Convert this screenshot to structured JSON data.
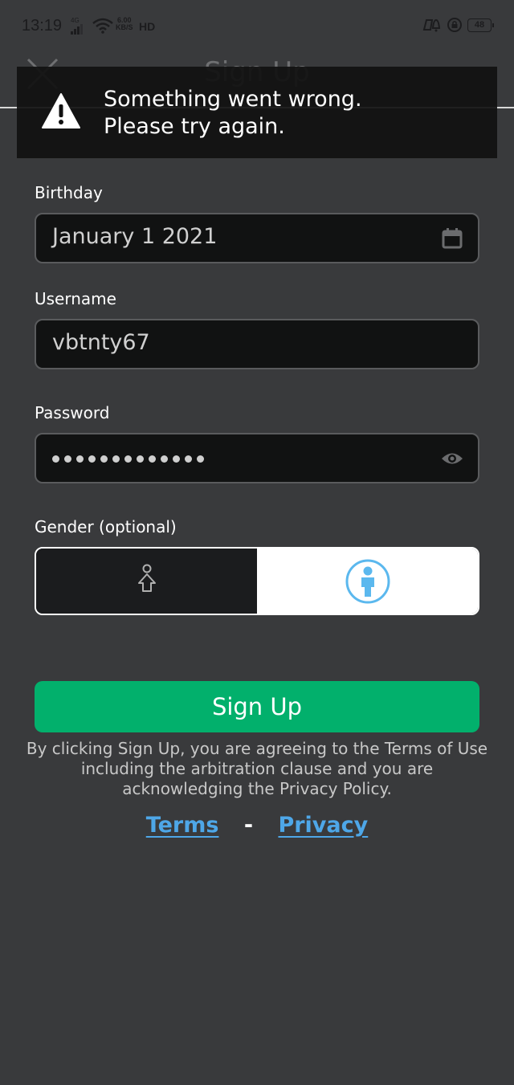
{
  "status_bar": {
    "time": "13:19",
    "network": "4G",
    "speed_value": "6.00",
    "speed_unit": "KB/S",
    "hd_label": "HD",
    "battery": "48",
    "icons": [
      "signal-icon",
      "wifi-icon",
      "hd-call-icon",
      "game-notification-icon",
      "rotation-lock-icon",
      "battery-icon"
    ]
  },
  "header": {
    "title": "Sign Up",
    "close_icon": "close-icon"
  },
  "toast": {
    "icon": "warning-icon",
    "line1": "Something went wrong.",
    "line2": "Please try again."
  },
  "form": {
    "birthday": {
      "label": "Birthday",
      "value": "January 1 2021",
      "icon": "calendar-icon"
    },
    "username": {
      "label": "Username",
      "value": "vbtnty67"
    },
    "password": {
      "label": "Password",
      "masked_length": 13,
      "icon": "eye-icon"
    },
    "gender": {
      "label": "Gender (optional)",
      "options": [
        {
          "name": "female",
          "icon": "female-icon",
          "selected": false
        },
        {
          "name": "male",
          "icon": "male-icon",
          "selected": true
        }
      ]
    }
  },
  "signup_button": {
    "label": "Sign Up",
    "color": "#02b06c"
  },
  "legal": {
    "text": "By clicking Sign Up, you are agreeing to the Terms of Use including the arbitration clause and you are acknowledging the Privacy Policy."
  },
  "links": {
    "terms": "Terms",
    "separator": "-",
    "privacy": "Privacy",
    "color": "#4ea7e8"
  }
}
